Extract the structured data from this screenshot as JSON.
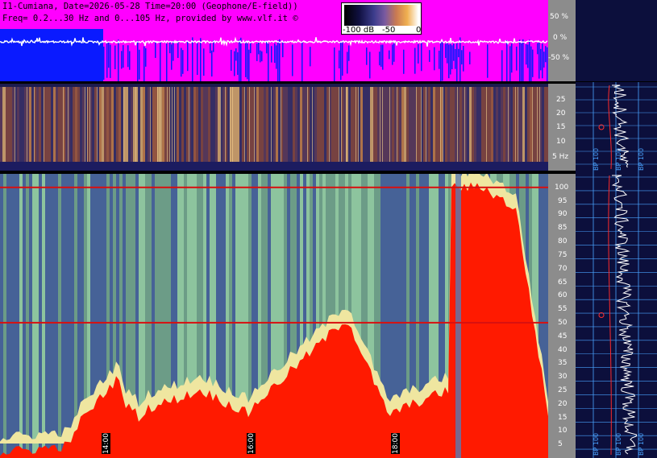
{
  "header": {
    "line1": "I1-Cumiana, Date=2026-05-28 Time=20:00 (Geophone/E-field))",
    "line2": "Freq= 0.2...30 Hz and 0...105 Hz, provided by www.vlf.it ©"
  },
  "colorbar": {
    "min_label": "-100 dB",
    "mid_label": "-50",
    "max_label": "0"
  },
  "colors": {
    "magenta_bg": "#ff00ff",
    "blue_trace": "#0a1aff",
    "red_band": "#ff1a00",
    "right_panel_bg": "#0c0f3c",
    "axis_panel_bg": "#8c8c8c",
    "grid_blue": "#4aa3ff"
  },
  "chart_data": [
    {
      "type": "line",
      "panel": "waveform",
      "y_ticks": [
        "50 %",
        "0 %",
        "-50 %"
      ],
      "y_values": [
        50,
        0,
        -50
      ],
      "ylim": [
        -100,
        100
      ],
      "grid": false
    },
    {
      "type": "heatmap",
      "panel": "geophone-spectrogram",
      "y_ticks": [
        "25",
        "20",
        "15",
        "10",
        "5 Hz"
      ],
      "y_values": [
        25,
        20,
        15,
        10,
        5
      ],
      "ylim": [
        0,
        30
      ]
    },
    {
      "type": "heatmap",
      "panel": "efield-spectrogram",
      "y_ticks": [
        "100",
        "95",
        "90",
        "85",
        "80",
        "75",
        "70",
        "65",
        "60",
        "55",
        "50",
        "45",
        "40",
        "35",
        "30",
        "25",
        "20",
        "15",
        "10",
        "5"
      ],
      "y_values": [
        100,
        95,
        90,
        85,
        80,
        75,
        70,
        65,
        60,
        55,
        50,
        45,
        40,
        35,
        30,
        25,
        20,
        15,
        10,
        5
      ],
      "ylim": [
        0,
        105
      ],
      "x_ticks": [
        "14:00",
        "16:00",
        "18:00"
      ],
      "highlight_lines_hz": [
        50,
        100
      ]
    },
    {
      "type": "line",
      "panel": "spectrum-profile",
      "x_ticks": [
        "BP 100",
        "BP 100",
        "BP 100"
      ]
    }
  ]
}
